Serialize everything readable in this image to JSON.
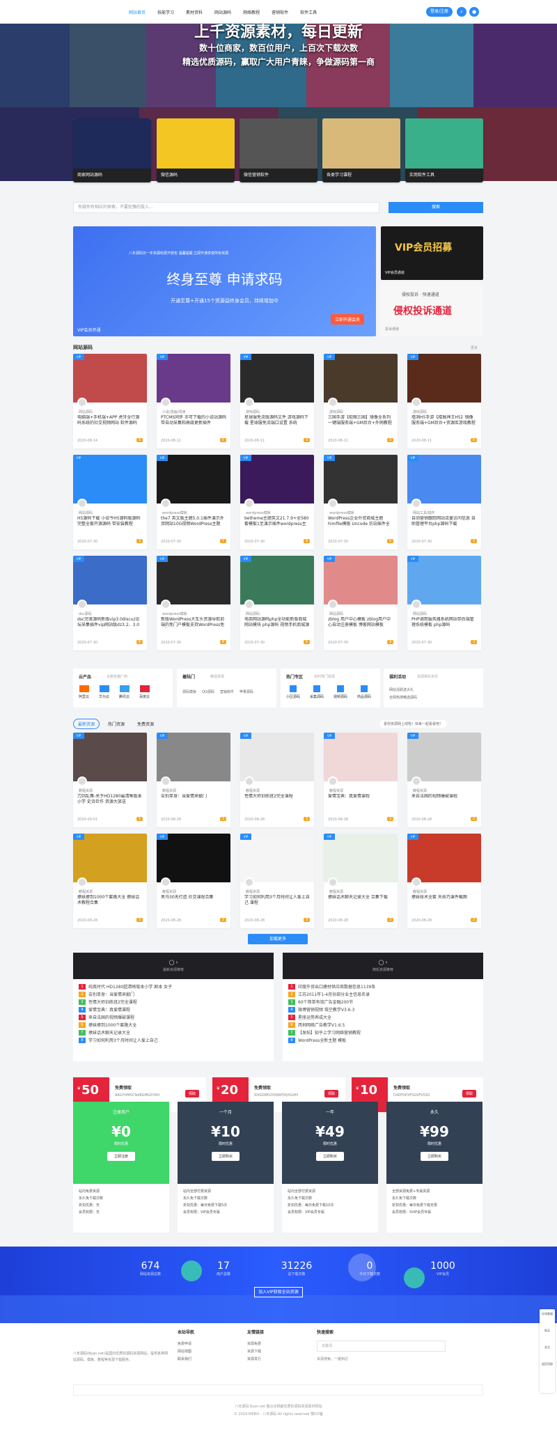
{
  "nav": [
    "网站首页",
    "技能学习",
    "素材资料",
    "网站源码",
    "网络教程",
    "营销软件",
    "软件工具"
  ],
  "header": {
    "btn": "登录/注册"
  },
  "hero": {
    "title": "上千资源素材，每日更新",
    "line1": "数十位商家，数百位用户，上百次下载次数",
    "line2": "精选优质源码，赢取广大用户青睐，争做源码第一商",
    "features": [
      "商家网站源码",
      "微信源码",
      "微信营销软件",
      "各类学习课程",
      "实用软件工具"
    ]
  },
  "search": {
    "placeholder": "有疑你有相应的探索，不要犹豫的投入...",
    "btn": "搜索"
  },
  "banner": {
    "small": "八年源码仅一年资源收费开放包 温馨提醒 立即开通享受所有资源",
    "title": "终身至尊 申请求码",
    "sub": "开通至尊+开通15个资源益终身会员，持续增加中",
    "btn": "立即开通会员",
    "tag": "VIP会员开通"
  },
  "vip1": {
    "title": "VIP会员招募",
    "cap": "VIP会员通道"
  },
  "vip2": {
    "top": "侵权投诉 · 快速通道",
    "title": "侵权投诉通道",
    "cap": "投诉通道"
  },
  "section1": {
    "title": "网站源码",
    "more": "更多"
  },
  "cards": [
    {
      "cat": "网站源码",
      "t": "电脑端+手机端+APP 虎牙全行源码系统的社交视频网站 软件源码",
      "d": "2020-08-14",
      "p": "5"
    },
    {
      "cat": "小说/漫画/阅读",
      "t": "PTCMS同步 亦可下载的小说站源码带自动采集和高级更新插件",
      "d": "2020-08-11",
      "p": "5"
    },
    {
      "cat": "游戏源码",
      "t": "星球服免流版源码文件 游戏源码下载 星球服免流端口设置 系统",
      "d": "2020-08-11",
      "p": "3"
    },
    {
      "cat": "游戏源码",
      "t": "三国手游【街图三国】镜像全系列一键端服务端+GM后台+外网教程",
      "d": "2020-08-11",
      "p": "3"
    },
    {
      "cat": "游戏源码",
      "t": "墙洞H5手游【楼厩神王H5】镜像服务端+GM后台+资源库游戏教程",
      "d": "2020-08-11",
      "p": "5"
    },
    {
      "cat": "网站源码",
      "t": "H5源码下载 小说今H5源码版源码 完整全套开源源码 带安装教程",
      "d": "2020-07-30",
      "p": "3"
    },
    {
      "cat": "wordpress模板",
      "t": "the7 英文版主题5.0.1插件演示外贸网站10G视频WordPress主题",
      "d": "2020-07-30",
      "p": "7"
    },
    {
      "cat": "wordpress模板",
      "t": "betheme主题英文21.7.9+全580套模板1至演示插件wordpress主题",
      "d": "2020-07-30",
      "p": "9"
    },
    {
      "cat": "wordpress模板",
      "t": "WordPress企业外贸商城主题 himfile模板 Uncode 仿站插件全套资源",
      "d": "2020-07-30",
      "p": "5"
    },
    {
      "cat": "网站工具/插件",
      "t": "自动营销跟踪网站流量访问信息 自助管理平台php源码下载",
      "d": "2020-07-30",
      "p": "3"
    },
    {
      "cat": "dsc源码",
      "t": "dsc完美源码新版vip3.0discuz论坛采集插件vip网站版dz3.2、3.0",
      "d": "2020-07-30",
      "p": "8"
    },
    {
      "cat": "wordpress模板",
      "t": "新版WordPress大车头资源导航前端的免门户模板支持WordPress免主题安装",
      "d": "2020-07-30",
      "p": "8"
    },
    {
      "cat": "网站源码",
      "t": "电商网站源码php全功能新版商城网站模块 php源码 视频手机商城源码",
      "d": "2020-07-30",
      "p": "5"
    },
    {
      "cat": "网站源码",
      "t": "zblog 用户中心模板 zblog用户中心自动注册模板 博客网站模板",
      "d": "2020-07-30",
      "p": "3"
    },
    {
      "cat": "网站源码",
      "t": "PHP调用服务器系统网站带后端管理系统模板 php源码",
      "d": "2020-07-30",
      "p": "3"
    }
  ],
  "cats": [
    {
      "h": "云产品",
      "s": "云服务器厂商",
      "items": [
        "阿里云",
        "华为云",
        "腾讯云",
        "百度云"
      ]
    },
    {
      "h": "着陆门",
      "s": "精选资源",
      "items": [
        "源码模板",
        "QQ源码",
        "营销软件",
        "苹果源码"
      ]
    },
    {
      "h": "热门专区",
      "s": "实时热门资源",
      "items": [
        "小区源码",
        "采集源码",
        "视频源码",
        "商品源码"
      ]
    },
    {
      "h": "福利活动",
      "s": "资源相关资讯",
      "items": [
        "网站活跃送大礼",
        "全网热搜精选源码"
      ]
    }
  ],
  "tabs": [
    "最新资源",
    "热门资源",
    "免费资源"
  ],
  "notice": "素材资源网上线啦！快来一起看看吧！",
  "cards2": [
    {
      "cat": "教程资源",
      "t": "刀剑乱舞-关于HD1280最清晰版本小学 史诗巨作 资源大放送",
      "d": "2020-09-01",
      "p": "5"
    },
    {
      "cat": "教程资源",
      "t": "告别单身：当爱情来敲门",
      "d": "2020-08-28",
      "p": "3"
    },
    {
      "cat": "教程资源",
      "t": "性情大师训练班2完全课程",
      "d": "2020-08-28",
      "p": "3"
    },
    {
      "cat": "教程资源",
      "t": "爱情宝典：真爱情课程",
      "d": "2020-08-28",
      "p": "3"
    },
    {
      "cat": "教程资源",
      "t": "来自法国的视频爆破课程",
      "d": "2020-08-28",
      "p": "3"
    },
    {
      "cat": "教程资源",
      "t": "撩妹撩到1000个套路大全 撩妹话术教程合集",
      "d": "2020-08-28",
      "p": "3"
    },
    {
      "cat": "教程资源",
      "t": "黑马30天打造 社交课程合集",
      "d": "2020-08-28",
      "p": "3"
    },
    {
      "cat": "教程资源",
      "t": "学习如何利用3个月时间让人爱上自己 课程",
      "d": "2020-08-28",
      "p": "3"
    },
    {
      "cat": "教程资源",
      "t": "撩妹话术聊天记录大全 合集下载",
      "d": "2020-08-28",
      "p": "3"
    },
    {
      "cat": "教程资源",
      "t": "撩妹技术全套 天技巧课件截图",
      "d": "2020-08-28",
      "p": "3"
    }
  ],
  "more_btn": "加载更多",
  "list1": {
    "title": "最新资源推荐",
    "items": [
      "纯真时代 HD1280超清晰版本小学 剧本 女子",
      "告别单身：当爱情来敲门",
      "性情大师训练班2完全课程",
      "爱情宝典：真爱情课程",
      "来自法国的视频爆破课程",
      "撩妹撩到1000个套路大全",
      "撩妹话术聊天记录大全",
      "学习如何利用3个月时间让人爱上自己"
    ]
  },
  "list2": {
    "title": "随机资源推荐",
    "items": [
      "印度外贸出口建材供应商数据信息1139条",
      "江苏2011年1-4月份部分业主信息名录",
      "60个简单有效广告金融200节",
      "微博营销视频 悟空教学V3.6.3",
      "星座运势养成大全",
      "西祠网络广告教学V1.6.5",
      "【发帖】知乎上学习网络营销教程",
      "WordPress全新主题 模板"
    ]
  },
  "coupons": [
    {
      "v": "50",
      "h": "免费领取",
      "c": "ARGYHMVCN48GMG5YRH",
      "b": "领取"
    },
    {
      "v": "20",
      "h": "免费领取",
      "c": "N3GD8EGYD6NF0Q5GHH",
      "b": "领取"
    },
    {
      "v": "10",
      "h": "免费领取",
      "c": "D40FDPXFSG0FS5SD",
      "b": "领取"
    }
  ],
  "plans": [
    {
      "n": "注册用户",
      "p": "0",
      "d": "限时优惠",
      "b": "立即注册",
      "f": [
        "站内免费资源",
        "永久免下载次数",
        "折扣优惠：无",
        "会员权限：无"
      ]
    },
    {
      "n": "一个月",
      "p": "10",
      "d": "限时优惠",
      "b": "立即购买",
      "f": [
        "站内全部付费资源",
        "永久免下载次数",
        "折扣优惠：每日免费下载5次",
        "会员权限：VIP会员专属"
      ]
    },
    {
      "n": "一年",
      "p": "49",
      "d": "限时优惠",
      "b": "立即购买",
      "f": [
        "站内全部付费资源",
        "永久免下载次数",
        "折扣优惠：每日免费下载10次",
        "会员权限：VIP会员专属"
      ]
    },
    {
      "n": "永久",
      "p": "99",
      "d": "限时优惠",
      "b": "立即购买",
      "f": [
        "全部资源免费+专属资源",
        "永久免下载次数",
        "折扣优惠：每日免费下载无限",
        "会员权限：SVIP会员专属"
      ]
    }
  ],
  "stats": [
    {
      "v": "674",
      "l": "网站资源总数"
    },
    {
      "v": "17",
      "l": "用户总数"
    },
    {
      "v": "31226",
      "l": "总下载次数"
    },
    {
      "v": "0",
      "l": "今日下载次数"
    },
    {
      "v": "1000",
      "l": "VIP会员"
    }
  ],
  "join": "加入VIP获取全站资源",
  "footer": {
    "about": "八年源码(8yan.net)是国内优质的源码资源网站，提供各类网站源码、模板、教程等资源下载服务。",
    "c1": {
      "h": "本站导航",
      "i": [
        "免费申请",
        "网站地图",
        "联系我们"
      ]
    },
    "c2": {
      "h": "友情链接",
      "i": [
        "资源免费",
        "资源下载",
        "资源发行"
      ]
    },
    "c3": {
      "h": "快速搜索",
      "ph": "关键词",
      "note": "资源搜索，一键到达"
    },
    "copy": "八年源码 8yan.net 整合全网最优质的源码资源素材网站",
    "copy2": "© 2019 RIPRO - 八年源码 All rights reserved 豫ICP备"
  },
  "side": [
    "在线客服",
    "购买",
    "关注",
    "返回顶部"
  ]
}
